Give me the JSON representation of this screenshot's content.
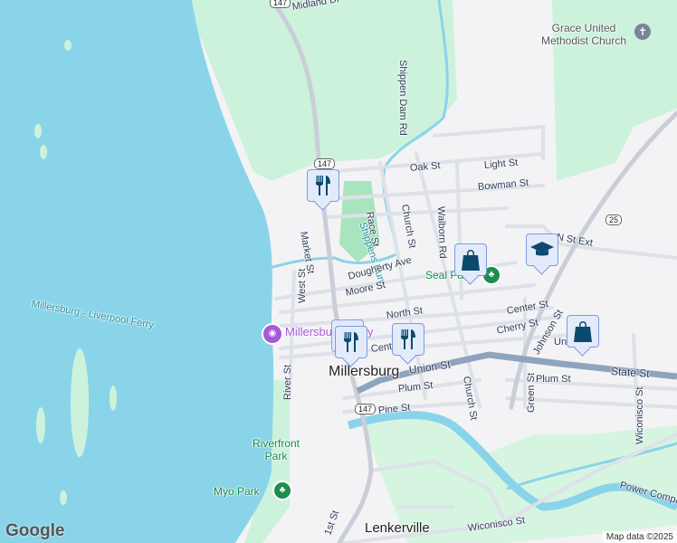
{
  "colors": {
    "water": "#8ad4ea",
    "park": "#cdf2dc",
    "road": "#ffffff",
    "highway": "#8ea3bd",
    "marker_fill": "#e3ebfb",
    "marker_border": "#7d9be0",
    "icon": "#0b4a6e"
  },
  "labels": {
    "midland_dr": "Midland Dr",
    "shippen_dam_rd": "Shippen Dam Rd",
    "grace_church": "Grace United Methodist Church",
    "oak_st": "Oak St",
    "light_st": "Light St",
    "bowman_st": "Bowman St",
    "race_st": "Race St",
    "church_st": "Church St",
    "walborn_rd": "Walborn Rd",
    "shippens_run": "Shippens Run",
    "market_st": "Market St",
    "n_st_ext": "N St Ext",
    "dougherty_ave": "Dougherty Ave",
    "seal_park": "Seal Park",
    "moore_st": "Moore St",
    "west_st": "West St",
    "north_st": "North St",
    "center_st": "Center St",
    "cherry_st": "Cherry St",
    "johnson_st": "Johnson St",
    "union_st_e": "Union St",
    "ferry": "Millersburg - Liverpool Ferry",
    "millersburg_ferry": "Millersburg Ferry",
    "center_st_w": "Center St",
    "millersburg": "Millersburg",
    "union_st": "Union St",
    "state_st": "State St",
    "plum_st": "Plum St",
    "plum_st_e": "Plum St",
    "church_st_s": "Church St",
    "green_st": "Green St",
    "wiconisco_st_n": "Wiconisco St",
    "river_st": "River St",
    "pine_st": "Pine St",
    "riverfront_park": "Riverfront Park",
    "myo_park": "Myo Park",
    "first_st": "1st St",
    "lenkerville": "Lenkerville",
    "wiconisco_st": "Wiconisco St",
    "power_company": "Power Company"
  },
  "shields": {
    "r147_top": "147",
    "r147_mid": "147",
    "r147_low": "147",
    "r25": "25"
  },
  "markers": [
    {
      "type": "restaurant",
      "icon": "fork-knife-icon"
    },
    {
      "type": "shopping",
      "icon": "shopping-bag-icon"
    },
    {
      "type": "school",
      "icon": "graduation-cap-icon"
    },
    {
      "type": "restaurant",
      "icon": "fork-knife-icon"
    },
    {
      "type": "restaurant",
      "icon": "fork-knife-icon"
    },
    {
      "type": "shopping",
      "icon": "shopping-bag-icon"
    }
  ],
  "footer": {
    "logo": "Google",
    "attribution": "Map data ©2025"
  }
}
